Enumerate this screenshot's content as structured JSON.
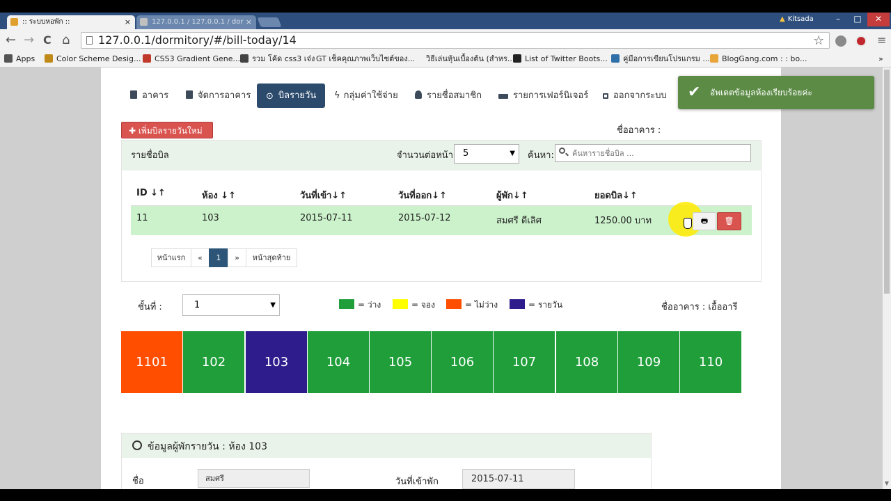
{
  "browser": {
    "tabs": [
      {
        "title": ":: ระบบหอพัก ::"
      },
      {
        "title": "127.0.0.1 / 127.0.0.1 / dor"
      }
    ],
    "close_glyph": "×",
    "profile_name": "Kitsada",
    "window_buttons": {
      "minimize": "–",
      "maximize": "□",
      "close": "✕"
    },
    "nav": {
      "back": "←",
      "forward": "→",
      "reload": "C",
      "home": "⌂"
    },
    "url": "127.0.0.1/dormitory/#/bill-today/14",
    "star": "☆",
    "menu": "≡",
    "bookmarks": [
      {
        "label": "Apps",
        "color": "#555555"
      },
      {
        "label": "Color Scheme Desig...",
        "color": "#c08a1a"
      },
      {
        "label": "CSS3 Gradient Gene...",
        "color": "#c0392b"
      },
      {
        "label": "รวม โค้ด css3 เจ๋ง",
        "color": "#444444"
      },
      {
        "label": "GT เช็คคุณภาพเว็บไซต์ของ...",
        "color": "#f2f2f2"
      },
      {
        "label": "วิธีเล่นหุ้นเบื้องต้น (สำหร...",
        "color": "#222222"
      },
      {
        "label": "List of Twitter Boots...",
        "color": "#2f6fa8"
      },
      {
        "label": "คู่มือการเขียนโปรแกรม ...",
        "color": "#e8a63a"
      },
      {
        "label": "BlogGang.com : : bo...",
        "color": "#3d8a40"
      }
    ],
    "bookmarks_more": "»"
  },
  "nav": {
    "items": [
      {
        "label": "อาคาร"
      },
      {
        "label": "จัดการอาคาร"
      },
      {
        "label": "บิลรายวัน",
        "icon": "⊙"
      },
      {
        "label": "กลุ่มค่าใช้จ่าย",
        "icon": "ϟ"
      },
      {
        "label": "รายชื่อสมาชิก"
      },
      {
        "label": "รายการเฟอร์นิเจอร์"
      },
      {
        "label": "ออกจากระบบ"
      }
    ]
  },
  "toast": {
    "message": "อัพเดตข้อมูลห้องเรียบร้อยค่ะ",
    "check": "✔"
  },
  "add_button": "✚ เพิ่มบิลรายวันใหม่",
  "building_label": "ชื่ออาคาร :",
  "bill_panel": {
    "title": "รายชื่อบิล",
    "per_page_label": "จำนวนต่อหน้า:",
    "per_page_value": "5",
    "search_label": "ค้นหา:",
    "search_placeholder": "ค้นหารายชื่อบิล ...",
    "caret": "▼",
    "columns": [
      "ID ↓↑",
      "ห้อง ↓↑",
      "วันที่เข้า↓↑",
      "วันที่ออก↓↑",
      "ผู้พัก↓↑",
      "ยอดบิล↓↑"
    ],
    "rows": [
      {
        "id": "11",
        "room": "103",
        "check_in": "2015-07-11",
        "check_out": "2015-07-12",
        "guest": "สมศรี ดีเลิศ",
        "total": "1250.00 บาท"
      }
    ],
    "print_icon": "🖶",
    "delete_icon": "🗑"
  },
  "pagination": {
    "first": "หน้าแรก",
    "prev": "«",
    "current": "1",
    "next": "»",
    "last": "หน้าสุดท้าย"
  },
  "floor": {
    "label": "ชั้นที่ :",
    "value": "1"
  },
  "legend": [
    {
      "label": "= ว่าง",
      "color": "#1f9e3a"
    },
    {
      "label": "= จอง",
      "color": "#ffff00"
    },
    {
      "label": "= ไม่ว่าง",
      "color": "#ff4e00"
    },
    {
      "label": "= รายวัน",
      "color": "#2e1b8c"
    }
  ],
  "building_name": "ชื่ออาคาร : เอื้ออารี",
  "rooms": [
    {
      "number": "1101",
      "color": "#ff4e00"
    },
    {
      "number": "102",
      "color": "#1f9e3a"
    },
    {
      "number": "103",
      "color": "#2e1b8c"
    },
    {
      "number": "104",
      "color": "#1f9e3a"
    },
    {
      "number": "105",
      "color": "#1f9e3a"
    },
    {
      "number": "106",
      "color": "#1f9e3a"
    },
    {
      "number": "107",
      "color": "#1f9e3a"
    },
    {
      "number": "108",
      "color": "#1f9e3a"
    },
    {
      "number": "109",
      "color": "#1f9e3a"
    },
    {
      "number": "110",
      "color": "#1f9e3a"
    }
  ],
  "guest_panel": {
    "title": "ข้อมูลผู้พักรายวัน : ห้อง 103",
    "name_label": "ชื่อ",
    "name_value": "สมศรี",
    "checkin_label": "วันที่เข้าพัก",
    "checkin_value": "2015-07-11"
  }
}
